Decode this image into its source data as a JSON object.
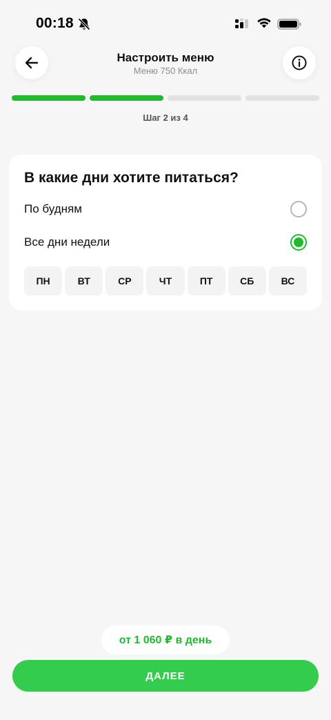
{
  "status_bar": {
    "time": "00:18"
  },
  "header": {
    "title": "Настроить меню",
    "subtitle": "Меню 750 Ккал"
  },
  "progress": {
    "current_step": 2,
    "total_steps": 4,
    "step_label": "Шаг 2 из 4"
  },
  "card": {
    "title": "В какие дни хотите питаться?",
    "options": [
      {
        "label": "По будням",
        "selected": false
      },
      {
        "label": "Все дни недели",
        "selected": true
      }
    ],
    "days": [
      "ПН",
      "ВТ",
      "СР",
      "ЧТ",
      "ПТ",
      "СБ",
      "ВС"
    ]
  },
  "price": {
    "label": "от 1 060 ₽ в день"
  },
  "next_button": {
    "label": "ДАЛЕЕ"
  },
  "colors": {
    "accent": "#1fbb2f",
    "button": "#33cc4d",
    "background": "#f6f6f6"
  }
}
